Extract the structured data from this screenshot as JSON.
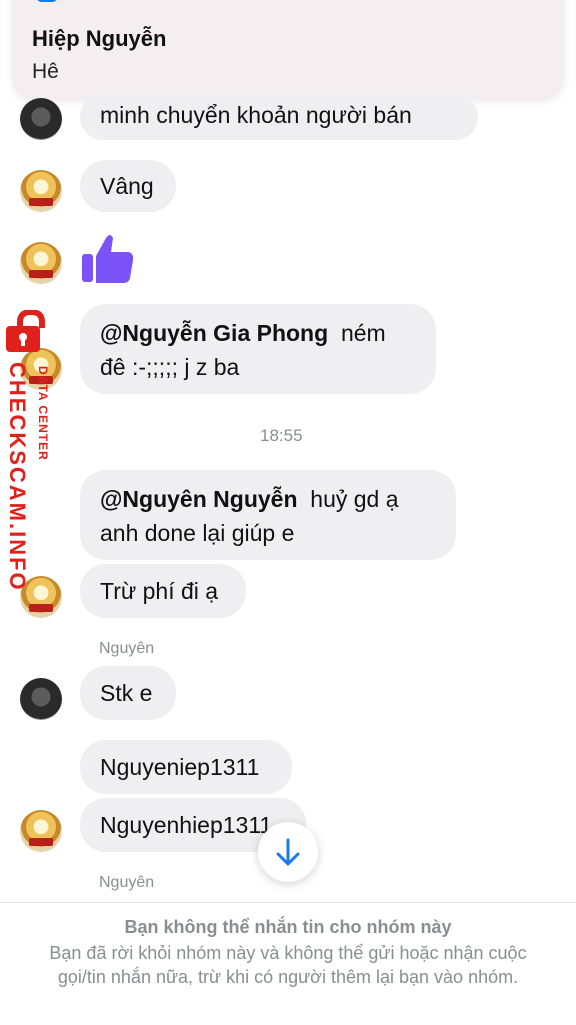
{
  "notification": {
    "sender": "Hiệp Nguyễn",
    "message": "Hê"
  },
  "messages": {
    "m1": "minh chuyển khoản người bán",
    "m2": "Vâng",
    "m4_mention": "@Nguyễn Gia Phong",
    "m4_text_a": "ném",
    "m4_text_b": "đê :-;;;;; j z ba",
    "timestamp": "18:55",
    "m5_mention": "@Nguyên Nguyễn",
    "m5_text_a": "huỷ gd ạ",
    "m5_text_b": "anh done lại giúp e",
    "m6": "Trừ phí đi ạ",
    "sender1": "Nguyên",
    "m7": "Stk e",
    "m8": "Nguyeniep1311",
    "m9": "Nguyenhiep1311",
    "sender2": "Nguyên"
  },
  "watermark": {
    "brand": "CHECKSCAM.INFO",
    "sub": "DATA CENTER",
    "color": "#e0201b"
  },
  "footer": {
    "title": "Bạn không thể nhắn tin cho nhóm này",
    "body": "Bạn đã rời khỏi nhóm này và không thể gửi hoặc nhận cuộc gọi/tin nhắn nữa, trừ khi có người thêm lại bạn vào nhóm."
  },
  "colors": {
    "bubble": "#efeff1",
    "like": "#7b52f5",
    "scroll_arrow": "#1877f2"
  },
  "icons": {
    "like": "thumbs-up-icon",
    "scroll": "arrow-down-icon",
    "lock": "lock-icon"
  }
}
